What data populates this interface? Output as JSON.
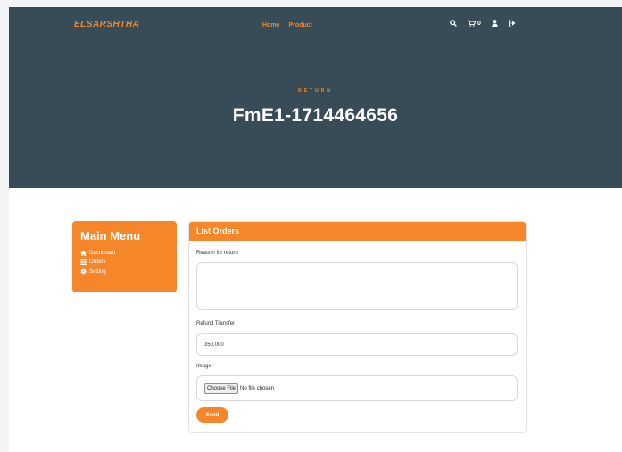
{
  "header": {
    "brand": "ELSARSHTHA",
    "nav": [
      "Home",
      "Product"
    ],
    "cart_count": "0"
  },
  "hero": {
    "eyebrow": "RETURN",
    "title": "FmE1-1714464656"
  },
  "menu": {
    "title": "Main Menu",
    "items": [
      "Dashboard",
      "Orders",
      "Setting"
    ]
  },
  "form": {
    "title": "List Orders",
    "reason_label": "Reason for return",
    "reason_value": "",
    "refund_label": "Refund Transfer",
    "refund_value": "350,000",
    "image_label": "Image",
    "file_button": "Choose File",
    "file_status": "No file chosen",
    "send_label": "Send"
  },
  "colors": {
    "accent": "#f5862a",
    "hero_bg": "#384c57"
  }
}
